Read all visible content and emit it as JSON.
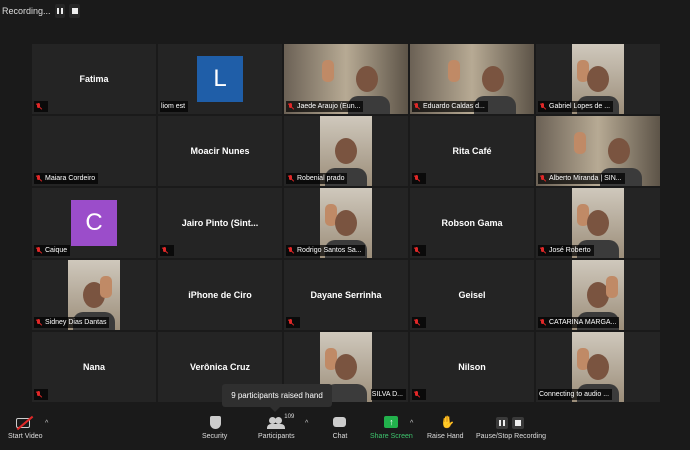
{
  "recording": {
    "label": "Recording..."
  },
  "tiles": {
    "r1c1": {
      "name": "Fatima"
    },
    "r1c2": {
      "label": "liom est",
      "avatar_letter": "L"
    },
    "r1c3": {
      "label": "Jaede Araujo (Eun..."
    },
    "r1c4": {
      "label": "Eduardo Caldas d..."
    },
    "r1c5": {
      "label": "Gabriel Lopes de ..."
    },
    "r2c1": {
      "label": "Maiara Cordeiro"
    },
    "r2c2": {
      "name": "Moacir Nunes"
    },
    "r2c3": {
      "label": "Robenial prado"
    },
    "r2c4": {
      "name": "Rita Café"
    },
    "r2c5": {
      "label": "Alberto Miranda | SIN..."
    },
    "r3c1": {
      "label": "Caique",
      "avatar_letter": "C"
    },
    "r3c2": {
      "name": "Jairo Pinto (Sint..."
    },
    "r3c3": {
      "label": "Rodrigo Santos Sa..."
    },
    "r3c4": {
      "name": "Robson Gama"
    },
    "r3c5": {
      "label": "José Roberto"
    },
    "r4c1": {
      "label": "Sidney Dias Dantas"
    },
    "r4c2": {
      "name": "iPhone de Ciro"
    },
    "r4c3": {
      "name": "Dayane Serrinha"
    },
    "r4c4": {
      "name": "Geisel"
    },
    "r4c5": {
      "label": "CATARINA MARGA..."
    },
    "r5c1": {
      "name": "Nana"
    },
    "r5c2": {
      "name": "Verônica Cruz"
    },
    "r5c3": {
      "label": "SILVA D..."
    },
    "r5c4": {
      "name": "Nilson"
    },
    "r5c5": {
      "label": "Connecting to audio ..."
    }
  },
  "toast": {
    "text": "9 participants raised hand"
  },
  "toolbar": {
    "start_video": "Start Video",
    "security": "Security",
    "participants": "Participants",
    "participants_count": "109",
    "chat": "Chat",
    "share_screen": "Share Screen",
    "raise_hand": "Raise Hand",
    "pause_stop_recording": "Pause/Stop Recording"
  },
  "colors": {
    "active_speaker_border": "#d4e157",
    "avatar_l": "#1f5ea8",
    "avatar_c": "#9b4dca",
    "muted": "#e02828",
    "share_screen": "#22b14c"
  },
  "icons": [
    "muted-mic-icon",
    "video-off-icon",
    "shield-icon",
    "people-icon",
    "chat-icon",
    "share-screen-icon",
    "raise-hand-icon",
    "pause-icon",
    "stop-icon"
  ]
}
